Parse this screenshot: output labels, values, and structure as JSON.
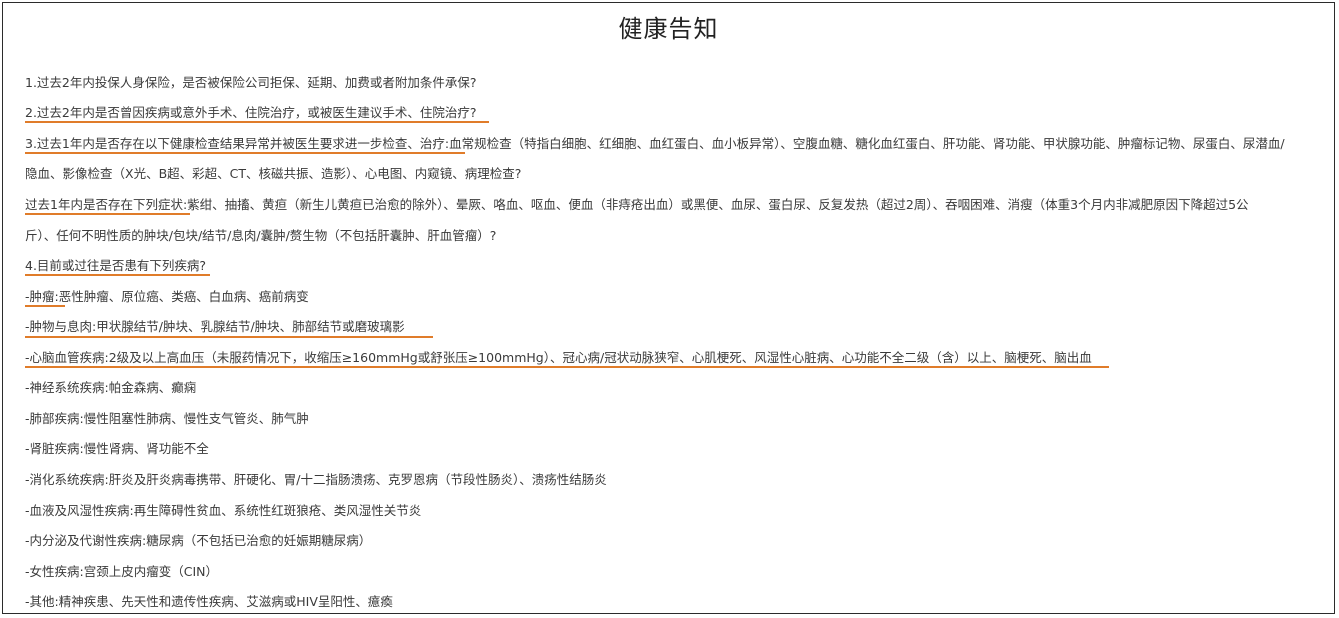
{
  "title": "健康告知",
  "q1": "1.过去2年内投保人身保险，是否被保险公司拒保、延期、加费或者附加条件承保?",
  "q2": "2.过去2年内是否曾因疾病或意外手术、住院治疗，或被医生建议手术、住院治疗?",
  "q3": {
    "lead": "3.过去1年内是否存在以下健康检查结果异常并被医生要求进一步检查、治疗:",
    "body": "血常规检查（特指白细胞、红细胞、血红蛋白、血小板异常）、空腹血糖、糖化血红蛋白、肝功能、肾功能、甲状腺功能、肿瘤标记物、尿蛋白、尿潜血/",
    "line2": "隐血、影像检查（X光、B超、彩超、CT、核磁共振、造影）、心电图、内窥镜、病理检查?"
  },
  "q3b": {
    "lead": "过去1年内是否存在下列症状:",
    "body": "紫绀、抽搐、黄疸（新生儿黄疸已治愈的除外）、晕厥、咯血、呕血、便血（非痔疮出血）或黑便、血尿、蛋白尿、反复发热（超过2周）、吞咽困难、消瘦（体重3个月内非减肥原因下降超过5公",
    "line2": "斤）、任何不明性质的肿块/包块/结节/息肉/囊肿/赘生物（不包括肝囊肿、肝血管瘤）?"
  },
  "q4": "4.目前或过往是否患有下列疾病?",
  "diseases": [
    {
      "label": "-肿瘤:",
      "text": "恶性肿瘤、原位癌、类癌、白血病、癌前病变"
    },
    {
      "label": "-肿物与息肉:",
      "text": "甲状腺结节/肿块、乳腺结节/肿块、肺部结节或磨玻璃影"
    },
    {
      "label": "-心脑血管疾病:",
      "text": "2级及以上高血压（未服药情况下，收缩压≥160mmHg或舒张压≥100mmHg）、冠心病/冠状动脉狭窄、心肌梗死、风湿性心脏病、心功能不全二级（含）以上、脑梗死、脑出血"
    },
    {
      "label": "-神经系统疾病:",
      "text": "帕金森病、癫痫"
    },
    {
      "label": "-肺部疾病:",
      "text": "慢性阻塞性肺病、慢性支气管炎、肺气肿"
    },
    {
      "label": "-肾脏疾病:",
      "text": "慢性肾病、肾功能不全"
    },
    {
      "label": "-消化系统疾病:",
      "text": "肝炎及肝炎病毒携带、肝硬化、胃/十二指肠溃疡、克罗恩病（节段性肠炎）、溃疡性结肠炎"
    },
    {
      "label": "-血液及风湿性疾病:",
      "text": "再生障碍性贫血、系统性红斑狼疮、类风湿性关节炎"
    },
    {
      "label": "-内分泌及代谢性疾病:",
      "text": "糖尿病（不包括已治愈的妊娠期糖尿病）"
    },
    {
      "label": "-女性疾病:",
      "text": "宫颈上皮内瘤变（CIN）"
    },
    {
      "label": "-其他:",
      "text": "精神疾患、先天性和遗传性疾病、艾滋病或HIV呈阳性、癔瘓"
    }
  ],
  "colors": {
    "underline": "#e07c2a",
    "text": "#3a3a3a",
    "border": "#2b2b2b"
  }
}
